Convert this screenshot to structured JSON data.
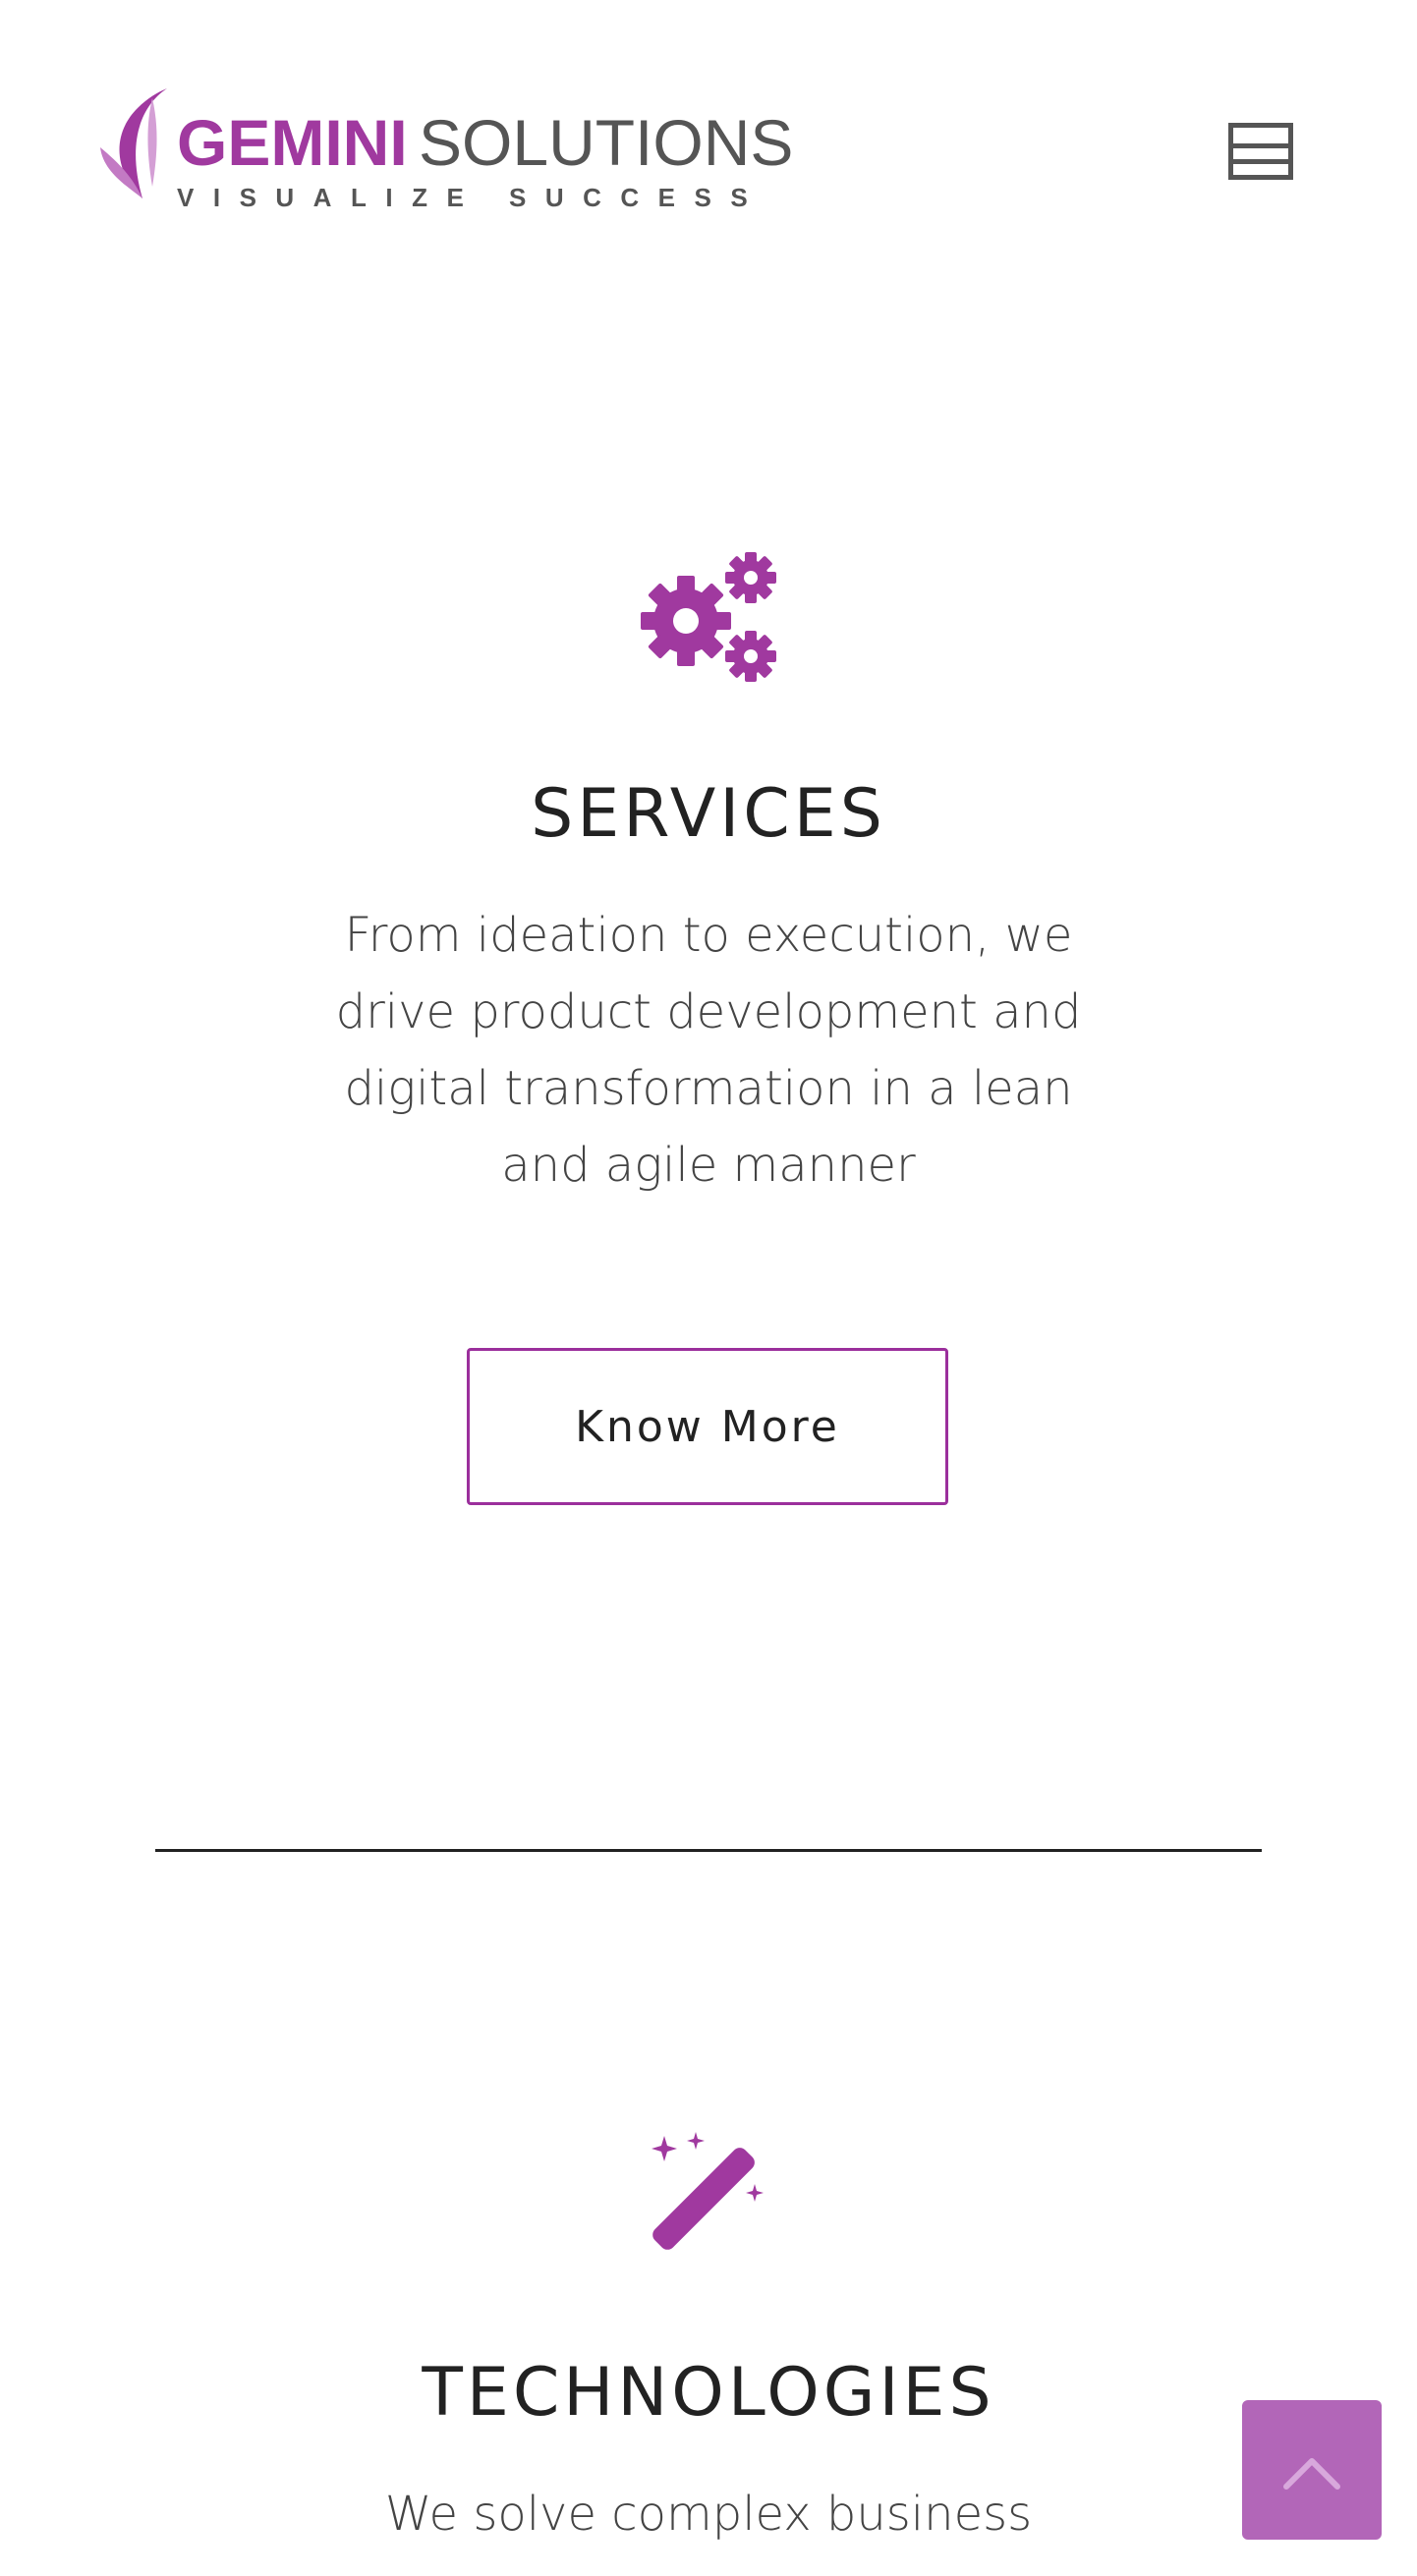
{
  "header": {
    "logo": {
      "brand_primary": "GEMINI",
      "brand_secondary": "SOLUTIONS",
      "tagline": "VISUALIZE SUCCESS"
    },
    "menu_icon": "hamburger-menu-icon"
  },
  "sections": [
    {
      "icon": "gears-icon",
      "title": "SERVICES",
      "description": "From ideation to execution, we drive product development and digital transformation in a lean and agile manner",
      "button_label": "Know More"
    },
    {
      "icon": "magic-wand-icon",
      "title": "TECHNOLOGIES",
      "description": "We solve complex business"
    }
  ],
  "scroll_top_icon": "chevron-up-icon",
  "colors": {
    "accent": "#a0399f",
    "button_border": "#9b2f9c",
    "scroll_top_bg": "#b266b8",
    "logo_gray": "#555555",
    "text": "#222222"
  }
}
